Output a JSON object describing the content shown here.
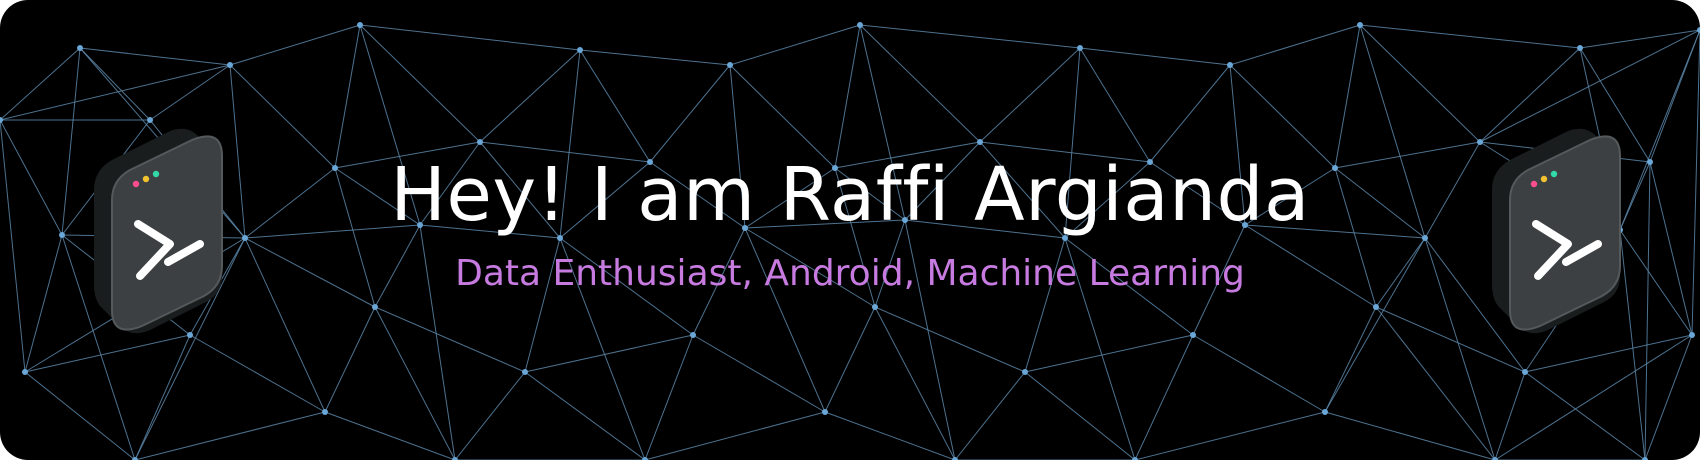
{
  "banner": {
    "title": "Hey! I am Raffi Argianda",
    "subtitle": "Data Enthusiast, Android, Machine Learning"
  },
  "icons": [
    "terminal-icon",
    "terminal-icon"
  ],
  "colors": {
    "background": "#000000",
    "title": "#ffffff",
    "subtitle": "#c77be0",
    "mesh_line": "#5b86a8",
    "mesh_node": "#6aa6d6",
    "dot_red": "#ff4d8d",
    "dot_yellow": "#f2c230",
    "dot_green": "#33d9a8"
  }
}
